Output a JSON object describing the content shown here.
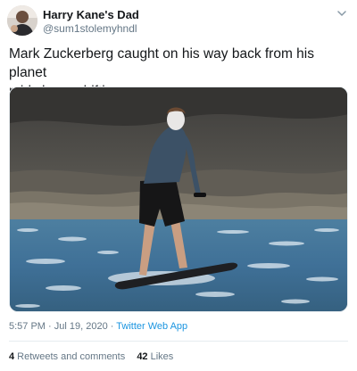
{
  "user": {
    "display_name": "Harry Kane's Dad",
    "handle": "@sum1stolemyhndl",
    "avatar_icon": "user-avatar"
  },
  "menu": {
    "icon": "chevron-down-icon"
  },
  "tweet": {
    "text_line1": "Mark Zuckerberg caught on his way back from his planet",
    "text_line2": "mid shape shifting"
  },
  "media": {
    "type": "photo",
    "depiction": "person riding electric hydrofoil surfboard on ocean waves"
  },
  "meta": {
    "time": "5:57 PM",
    "separator1": " · ",
    "date": "Jul 19, 2020",
    "separator2": " · ",
    "source": "Twitter Web App"
  },
  "stats": {
    "retweets_count": "4",
    "retweets_label": " Retweets and comments",
    "likes_count": "42",
    "likes_label": " Likes"
  },
  "colors": {
    "text": "#14171a",
    "secondary": "#657786",
    "link": "#1b95e0",
    "divider": "#e6ecf0"
  }
}
